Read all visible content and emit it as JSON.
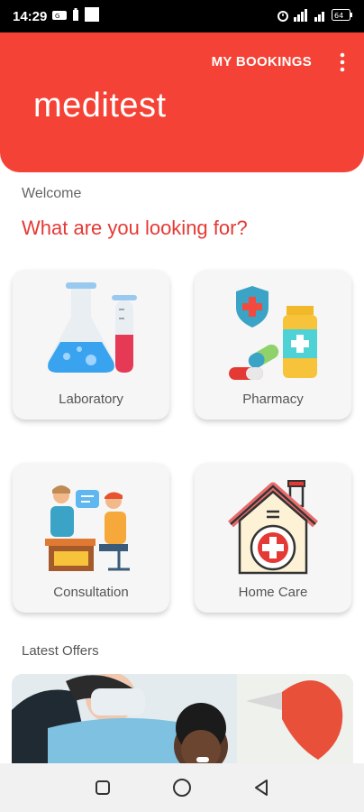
{
  "status_bar": {
    "time": "14:29",
    "battery_percent": "64"
  },
  "header": {
    "my_bookings_label": "MY BOOKINGS",
    "brand_name": "meditest",
    "accent_color": "#f44336"
  },
  "main": {
    "welcome": "Welcome",
    "question": "What are you looking for?",
    "services": [
      {
        "label": "Laboratory",
        "icon": "laboratory-flask-icon"
      },
      {
        "label": "Pharmacy",
        "icon": "pharmacy-pills-icon"
      },
      {
        "label": "Consultation",
        "icon": "consultation-doctor-icon"
      },
      {
        "label": "Home Care",
        "icon": "home-care-house-icon"
      }
    ],
    "offers_title": "Latest Offers"
  },
  "nav": {
    "icons": [
      "square-recents-icon",
      "circle-home-icon",
      "triangle-back-icon"
    ]
  }
}
